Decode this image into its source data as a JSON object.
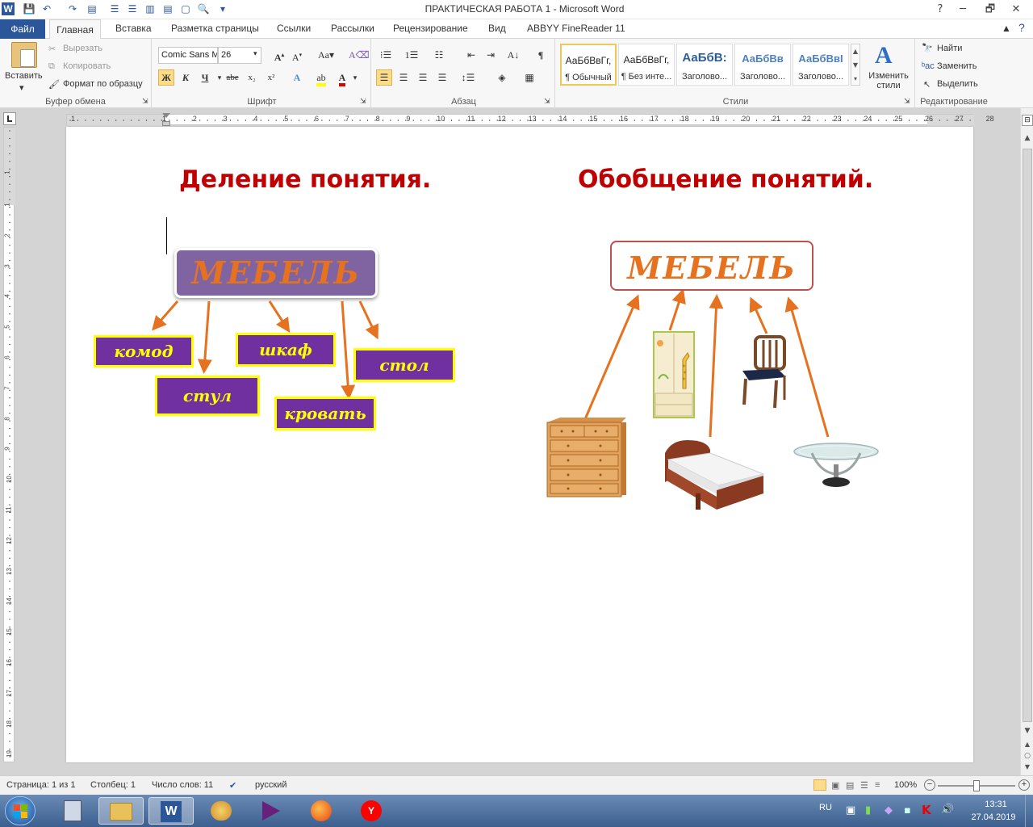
{
  "window": {
    "title": "ПРАКТИЧЕСКАЯ РАБОТА 1  -  Microsoft Word",
    "btn_help": "?",
    "btn_restore": "🗗",
    "btn_min": "─",
    "btn_close": "✕"
  },
  "tabs": [
    "Файл",
    "Главная",
    "Вставка",
    "Разметка страницы",
    "Ссылки",
    "Рассылки",
    "Рецензирование",
    "Вид",
    "ABBYY FineReader 11"
  ],
  "clipboard": {
    "paste": "Вставить",
    "cut": "Вырезать",
    "copy": "Копировать",
    "format_painter": "Формат по образцу",
    "label": "Буфер обмена"
  },
  "font": {
    "name": "Comic Sans M",
    "size": "26",
    "bold": "Ж",
    "italic": "К",
    "underline": "Ч",
    "strike": "abe",
    "sub": "x₂",
    "sup": "x²",
    "label": "Шрифт"
  },
  "paragraph": {
    "label": "Абзац"
  },
  "styles": {
    "label": "Стили",
    "items": [
      {
        "preview": "АаБбВвГг,",
        "name": "¶ Обычный"
      },
      {
        "preview": "АаБбВвГг,",
        "name": "¶ Без инте..."
      },
      {
        "preview": "АаБбВ:",
        "name": "Заголово..."
      },
      {
        "preview": "АаБбВв",
        "name": "Заголово..."
      },
      {
        "preview": "АаБбВвI",
        "name": "Заголово..."
      }
    ],
    "change": "Изменить стили"
  },
  "editing": {
    "find": "Найти",
    "replace": "Заменить",
    "select": "Выделить",
    "label": "Редактирование"
  },
  "ruler": {
    "h_ticks": [
      "1",
      "1",
      "2",
      "3",
      "4",
      "5",
      "6",
      "7",
      "8",
      "9",
      "10",
      "11",
      "12",
      "13",
      "14",
      "15",
      "16",
      "17",
      "18",
      "19",
      "20",
      "21",
      "22",
      "23",
      "24",
      "25",
      "26",
      "27",
      "28"
    ],
    "v_ticks": [
      "1",
      "1",
      "2",
      "3",
      "4",
      "5",
      "6",
      "7",
      "8",
      "9",
      "10",
      "11",
      "12",
      "13",
      "14",
      "15",
      "16",
      "17",
      "18",
      "19"
    ]
  },
  "doc": {
    "left_title": "Деление понятия.",
    "right_title": "Обобщение понятий.",
    "left_concept": "МЕБЕЛЬ",
    "right_concept": "МЕБЕЛЬ",
    "parts": [
      "комод",
      "шкаф",
      "стол",
      "стул",
      "кровать"
    ],
    "colors": {
      "title": "#c00000",
      "concept": "#e67220",
      "arrow": "#e67220",
      "box_fill": "#7030a0",
      "box_border": "#ffff00",
      "left_concept_fill": "#8064a2",
      "right_concept_border": "#c0504d"
    }
  },
  "status": {
    "page": "Страница: 1 из 1",
    "column": "Столбец: 1",
    "words": "Число слов: 11",
    "lang": "русский",
    "zoom": "100%"
  },
  "taskbar": {
    "lang": "RU",
    "time": "13:31",
    "date": "27.04.2019"
  }
}
